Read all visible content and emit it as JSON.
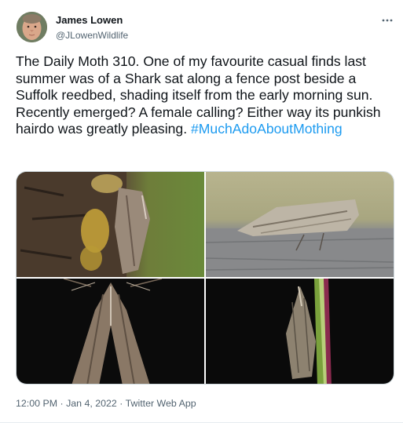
{
  "author": {
    "name": "James Lowen",
    "handle": "@JLowenWildlife",
    "avatar_icon": "profile-photo"
  },
  "more_icon": "more-dots-icon",
  "tweet": {
    "text": "The Daily Moth 310. One of my favourite casual finds last summer was of a Shark sat along a fence post beside a Suffolk reedbed, shading itself from the early morning sun. Recently emerged? A female calling? Either way its punkish hairdo was greatly pleasing.",
    "hashtag": "#MuchAdoAboutMothing"
  },
  "media": [
    {
      "name": "moth-on-lichen-post-photo"
    },
    {
      "name": "moth-on-wood-side-view-photo"
    },
    {
      "name": "moth-on-dark-background-top-view-photo"
    },
    {
      "name": "moth-on-grass-stem-photo"
    }
  ],
  "meta": {
    "time": "12:00 PM",
    "separator1": " · ",
    "date": "Jan 4, 2022",
    "separator2": " · ",
    "source": "Twitter Web App"
  },
  "colors": {
    "link": "#1d9bf0",
    "secondary_text": "#536471",
    "primary_text": "#0f1419"
  }
}
